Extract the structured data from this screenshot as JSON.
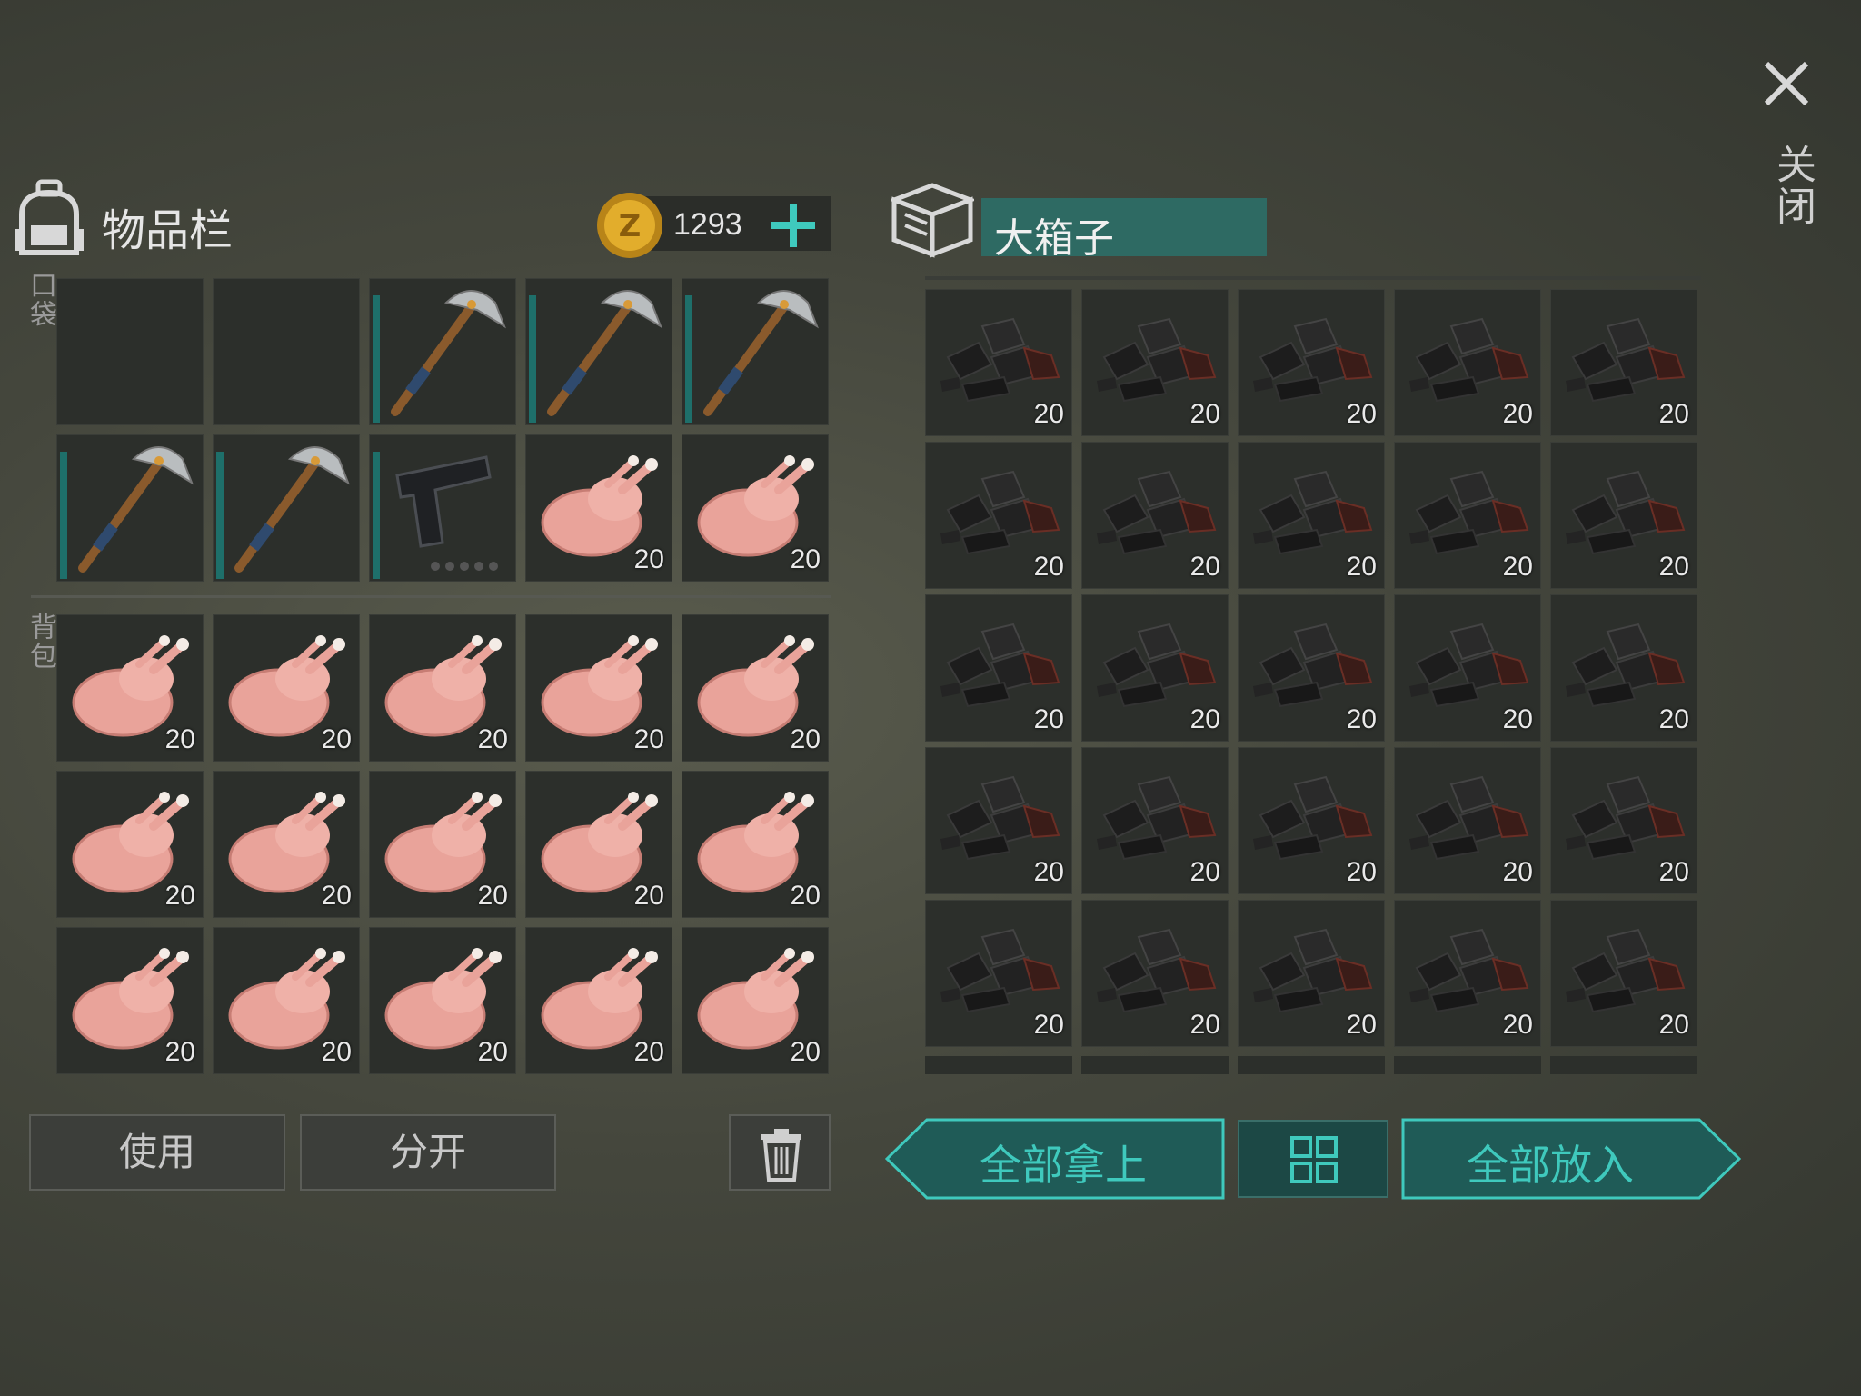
{
  "inventory": {
    "title": "物品栏",
    "coins": "1293",
    "pocket_label": "口袋",
    "backpack_label": "背包",
    "pocket_slots": [
      {
        "item": "",
        "count": "",
        "durability": false
      },
      {
        "item": "",
        "count": "",
        "durability": false
      },
      {
        "item": "pickaxe",
        "count": "",
        "durability": true
      },
      {
        "item": "pickaxe",
        "count": "",
        "durability": true
      },
      {
        "item": "pickaxe",
        "count": "",
        "durability": true
      },
      {
        "item": "pickaxe",
        "count": "",
        "durability": true
      },
      {
        "item": "pickaxe",
        "count": "",
        "durability": true
      },
      {
        "item": "pistol",
        "count": "",
        "durability": true
      },
      {
        "item": "chicken",
        "count": "20",
        "durability": false
      },
      {
        "item": "chicken",
        "count": "20",
        "durability": false
      }
    ],
    "backpack_slots": [
      {
        "item": "chicken",
        "count": "20"
      },
      {
        "item": "chicken",
        "count": "20"
      },
      {
        "item": "chicken",
        "count": "20"
      },
      {
        "item": "chicken",
        "count": "20"
      },
      {
        "item": "chicken",
        "count": "20"
      },
      {
        "item": "chicken",
        "count": "20"
      },
      {
        "item": "chicken",
        "count": "20"
      },
      {
        "item": "chicken",
        "count": "20"
      },
      {
        "item": "chicken",
        "count": "20"
      },
      {
        "item": "chicken",
        "count": "20"
      },
      {
        "item": "chicken",
        "count": "20"
      },
      {
        "item": "chicken",
        "count": "20"
      },
      {
        "item": "chicken",
        "count": "20"
      },
      {
        "item": "chicken",
        "count": "20"
      },
      {
        "item": "chicken",
        "count": "20"
      }
    ],
    "use_label": "使用",
    "split_label": "分开"
  },
  "chest": {
    "title": "大箱子",
    "slots": [
      {
        "item": "coal",
        "count": "20"
      },
      {
        "item": "coal",
        "count": "20"
      },
      {
        "item": "coal",
        "count": "20"
      },
      {
        "item": "coal",
        "count": "20"
      },
      {
        "item": "coal",
        "count": "20"
      },
      {
        "item": "coal",
        "count": "20"
      },
      {
        "item": "coal",
        "count": "20"
      },
      {
        "item": "coal",
        "count": "20"
      },
      {
        "item": "coal",
        "count": "20"
      },
      {
        "item": "coal",
        "count": "20"
      },
      {
        "item": "coal",
        "count": "20"
      },
      {
        "item": "coal",
        "count": "20"
      },
      {
        "item": "coal",
        "count": "20"
      },
      {
        "item": "coal",
        "count": "20"
      },
      {
        "item": "coal",
        "count": "20"
      },
      {
        "item": "coal",
        "count": "20"
      },
      {
        "item": "coal",
        "count": "20"
      },
      {
        "item": "coal",
        "count": "20"
      },
      {
        "item": "coal",
        "count": "20"
      },
      {
        "item": "coal",
        "count": "20"
      },
      {
        "item": "coal",
        "count": "20"
      },
      {
        "item": "coal",
        "count": "20"
      },
      {
        "item": "coal",
        "count": "20"
      },
      {
        "item": "coal",
        "count": "20"
      },
      {
        "item": "coal",
        "count": "20"
      }
    ],
    "take_all_label": "全部拿上",
    "put_all_label": "全部放入"
  },
  "close_label": "关闭",
  "colors": {
    "accent": "#3fc9bd",
    "teal_dark": "#1f5b57",
    "slot_bg": "#2c2f2b"
  }
}
